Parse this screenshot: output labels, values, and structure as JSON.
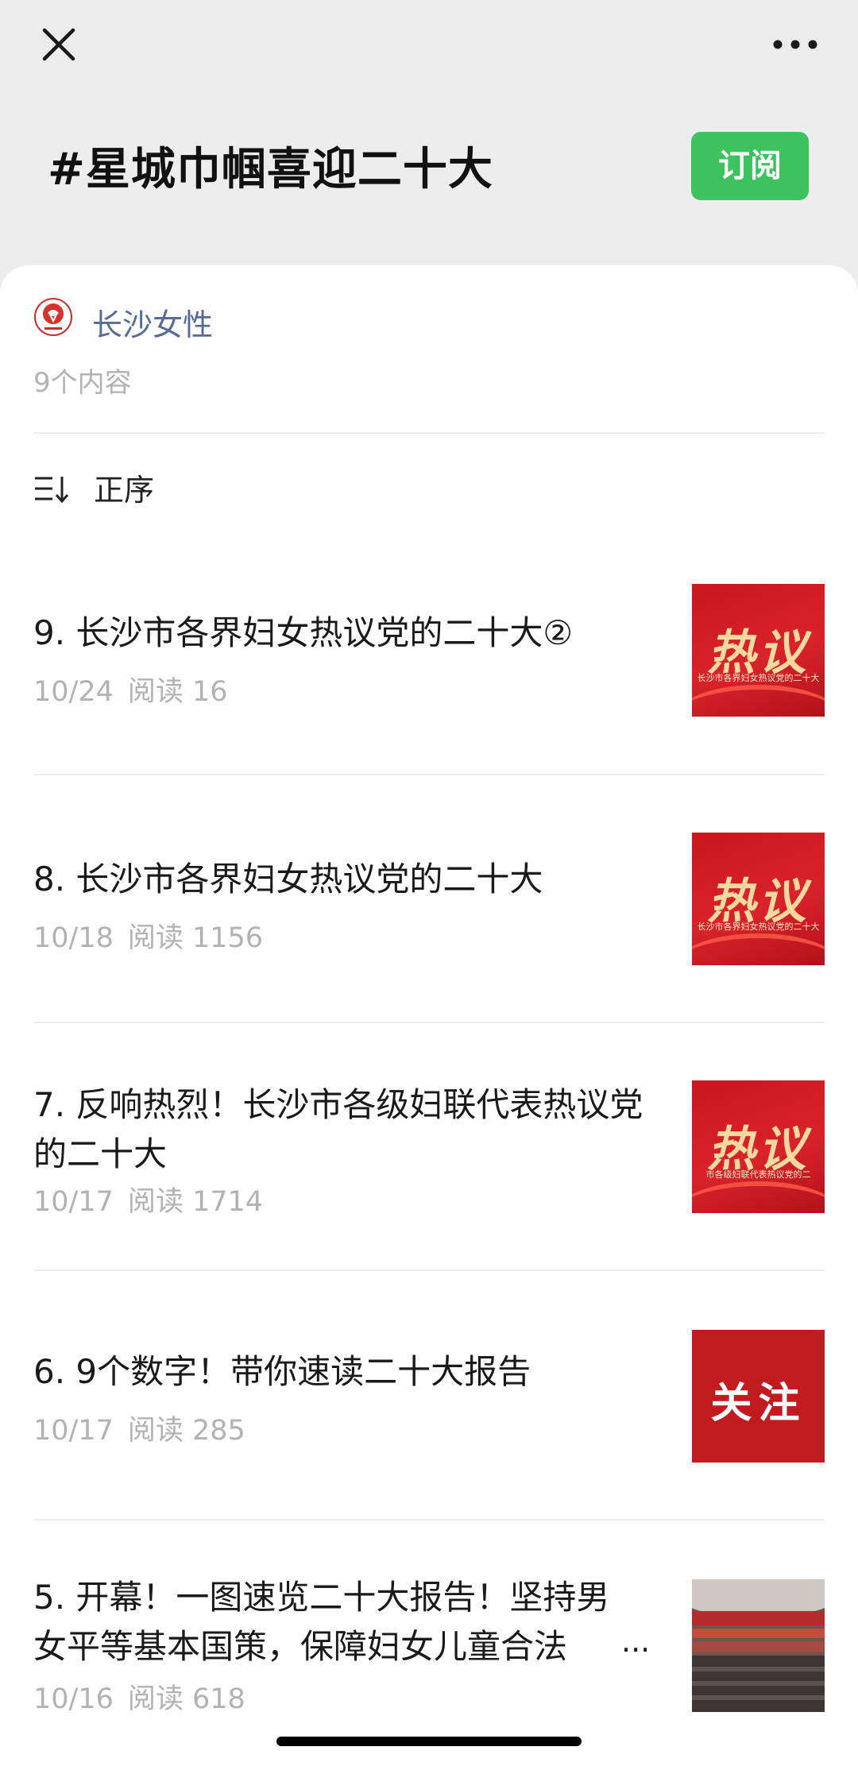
{
  "topbar": {
    "close_icon": "close-icon",
    "more_icon": "more-dots-icon"
  },
  "header": {
    "title": "#星城巾帼喜迎二十大",
    "subscribe_label": "订阅"
  },
  "account": {
    "name": "长沙女性",
    "logo_icon": "womens-federation-logo",
    "content_count": "9个内容"
  },
  "sort": {
    "icon": "sort-order-icon",
    "label": "正序"
  },
  "articles": [
    {
      "title": "9. 长沙市各界妇女热议党的二十大②",
      "date": "10/24",
      "reads": "阅读 16",
      "thumb_text": "热议",
      "thumb_caption": "长沙市各界妇女热议党的二十大"
    },
    {
      "title": "8. 长沙市各界妇女热议党的二十大",
      "date": "10/18",
      "reads": "阅读 1156",
      "thumb_text": "热议",
      "thumb_caption": "长沙市各界妇女热议党的二十大"
    },
    {
      "title": "7. 反响热烈！长沙市各级妇联代表热议党的二十大",
      "date": "10/17",
      "reads": "阅读 1714",
      "thumb_text": "热议",
      "thumb_caption": "市各级妇联代表热议党的二"
    },
    {
      "title": "6. 9个数字！带你速读二十大报告",
      "date": "10/17",
      "reads": "阅读 285",
      "thumb_text": "关注"
    },
    {
      "title": "5. 开幕！一图速览二十大报告！坚持男女平等基本国策，保障妇女儿童合法",
      "date": "10/16",
      "reads": "阅读 618",
      "ellipsis": "..."
    }
  ],
  "colors": {
    "accent_green": "#3ec25e",
    "account_link": "#576b95",
    "meta_gray": "#b2b2b2",
    "thumb_red": "#c8161d"
  }
}
